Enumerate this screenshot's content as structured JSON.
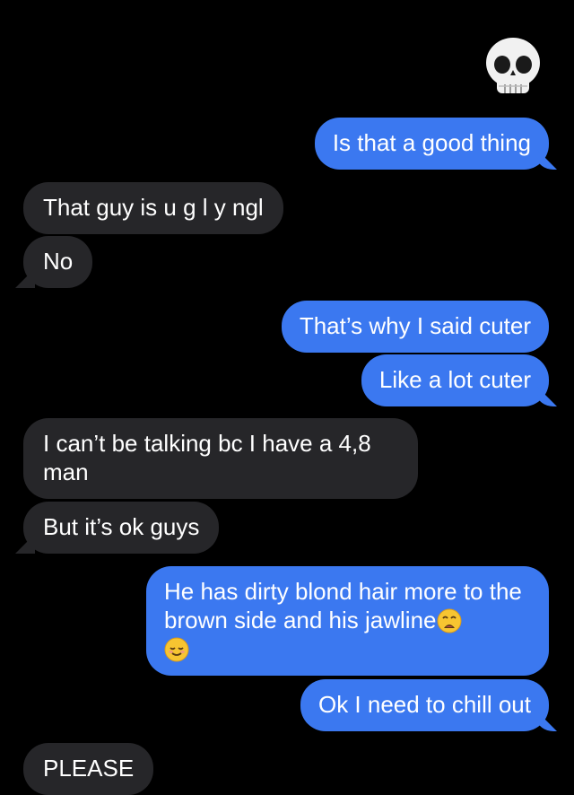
{
  "icons": {
    "skull": "skull-emoji",
    "weary": "weary-face-emoji",
    "relieved": "relieved-smiling-face-emoji"
  },
  "colors": {
    "background": "#000000",
    "outgoing_bubble": "#3b78f0",
    "incoming_bubble": "#262629",
    "text": "#ffffff"
  },
  "messages": [
    {
      "id": "m1",
      "direction": "outgoing",
      "text": "Is that a good thing"
    },
    {
      "id": "m2",
      "direction": "incoming",
      "text": "That guy is u g l y ngl"
    },
    {
      "id": "m3",
      "direction": "incoming",
      "text": "No"
    },
    {
      "id": "m4",
      "direction": "outgoing",
      "text": "That’s why I said cuter"
    },
    {
      "id": "m5",
      "direction": "outgoing",
      "text": "Like a lot cuter"
    },
    {
      "id": "m6",
      "direction": "incoming",
      "text": "I can’t be talking bc I have a 4,8 man"
    },
    {
      "id": "m7",
      "direction": "incoming",
      "text": "But it’s ok guys"
    },
    {
      "id": "m8",
      "direction": "outgoing",
      "text": "He has dirty blond hair more to the brown side and his jawline"
    },
    {
      "id": "m9",
      "direction": "outgoing",
      "text": "Ok I need to chill out"
    },
    {
      "id": "m10",
      "direction": "incoming",
      "text": "PLEASE"
    }
  ]
}
